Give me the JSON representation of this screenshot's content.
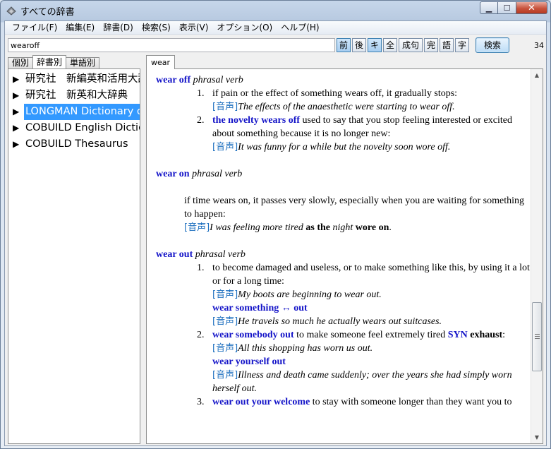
{
  "window": {
    "title": "すべての辞書",
    "controls": {
      "minimize": "▁",
      "maximize": "☐",
      "close": "✕"
    }
  },
  "menu": [
    "ファイル(F)",
    "編集(E)",
    "辞書(D)",
    "検索(S)",
    "表示(V)",
    "オプション(O)",
    "ヘルプ(H)"
  ],
  "toolbar": {
    "search_value": "wearoff",
    "buttons": [
      {
        "label": "前",
        "active": true
      },
      {
        "label": "後",
        "active": false
      },
      {
        "label": "キ",
        "active": true
      },
      {
        "label": "全",
        "active": false
      },
      {
        "label": "成句",
        "active": false
      },
      {
        "label": "完",
        "active": false
      },
      {
        "label": "語",
        "active": false
      },
      {
        "label": "字",
        "active": false
      }
    ],
    "search_button": "検索",
    "result_count": "34"
  },
  "left_tabs": [
    "個別",
    "辞書別",
    "単語別"
  ],
  "left_tab_selected": 1,
  "dictionaries": [
    {
      "label": "研究社　新編英和活用大辞典",
      "selected": false
    },
    {
      "label": "研究社　新英和大辞典",
      "selected": false
    },
    {
      "label": "LONGMAN Dictionary of Contemporary English",
      "selected": true
    },
    {
      "label": "COBUILD English Dictionary",
      "selected": false
    },
    {
      "label": "COBUILD Thesaurus",
      "selected": false
    }
  ],
  "result_tab": "wear",
  "entries": {
    "e1": {
      "headword": "wear off",
      "pos": "phrasal verb",
      "s1": {
        "num": "1.",
        "def": "if pain or the effect of something wears off, it gradually stops:",
        "onsei": "[音声]",
        "example": "The effects of the anaesthetic were starting to wear off."
      },
      "s2": {
        "num": "2.",
        "phrase": "the novelty wears off",
        "def": " used to say that you stop feeling interested or excited about something because it is no longer new:",
        "onsei": "[音声]",
        "example": "It was funny for a while but the novelty soon wore off."
      }
    },
    "e2": {
      "headword": "wear on",
      "pos": "phrasal verb",
      "def": "if time wears on, it passes very slowly, especially when you are waiting for something to happen:",
      "onsei": "[音声]",
      "ex_a": "I was feeling more tired ",
      "ex_b": "as the",
      "ex_c": " night ",
      "ex_d": "wore on",
      "ex_e": "."
    },
    "e3": {
      "headword": "wear out",
      "pos": "phrasal verb",
      "s1": {
        "num": "1.",
        "def": "to become damaged and useless, or to make something like this, by using it a lot or for a long time:",
        "onsei": "[音声]",
        "example": "My boots are beginning to wear out.",
        "phrase": "wear something ↔ out",
        "onsei2": "[音声]",
        "example2": "He travels so much he actually wears out suitcases."
      },
      "s2": {
        "num": "2.",
        "phrase": "wear somebody out",
        "def": " to make someone feel extremely tired ",
        "syn_label": "SYN",
        "syn_word": "exhaust",
        "colon": ":",
        "onsei": "[音声]",
        "example": "All this shopping has worn us out.",
        "phrase2": "wear yourself out",
        "onsei2": "[音声]",
        "example2": "Illness and death came suddenly; over the years she had simply worn herself out."
      },
      "s3": {
        "num": "3.",
        "phrase": "wear out your welcome",
        "def": " to stay with someone longer than they want you to"
      }
    }
  }
}
